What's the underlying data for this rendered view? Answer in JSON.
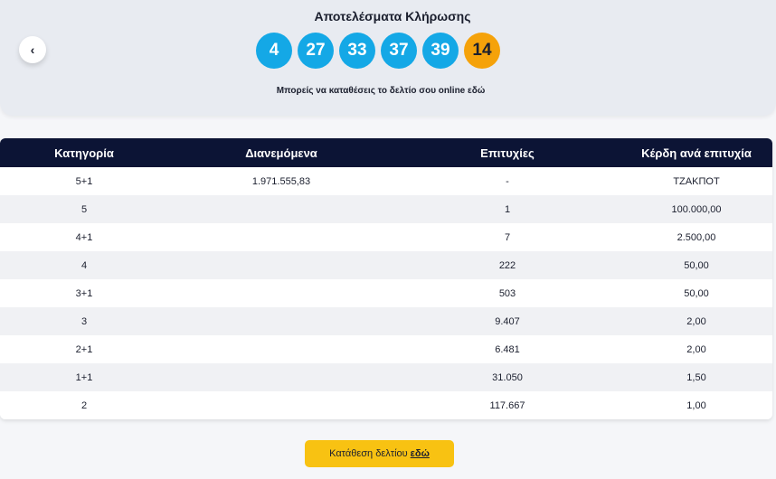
{
  "header": {
    "title": "Αποτελέσματα Κλήρωσης",
    "back_icon": "chevron-left-icon",
    "balls": [
      {
        "value": "4",
        "color": "#14a8e6",
        "kind": "main"
      },
      {
        "value": "27",
        "color": "#14a8e6",
        "kind": "main"
      },
      {
        "value": "33",
        "color": "#14a8e6",
        "kind": "main"
      },
      {
        "value": "37",
        "color": "#14a8e6",
        "kind": "main"
      },
      {
        "value": "39",
        "color": "#14a8e6",
        "kind": "main"
      },
      {
        "value": "14",
        "color": "#f5a20a",
        "kind": "joker"
      }
    ],
    "online_text": "Μπορείς να καταθέσεις το δελτίο σου online",
    "online_link": "εδώ"
  },
  "table": {
    "headers": [
      "Κατηγορία",
      "Διανεμόμενα",
      "Επιτυχίες",
      "Κέρδη ανά επιτυχία"
    ],
    "rows": [
      [
        "5+1",
        "1.971.555,83",
        "-",
        "ΤΖΑΚΠΟΤ"
      ],
      [
        "5",
        "",
        "1",
        "100.000,00"
      ],
      [
        "4+1",
        "",
        "7",
        "2.500,00"
      ],
      [
        "4",
        "",
        "222",
        "50,00"
      ],
      [
        "3+1",
        "",
        "503",
        "50,00"
      ],
      [
        "3",
        "",
        "9.407",
        "2,00"
      ],
      [
        "2+1",
        "",
        "6.481",
        "2,00"
      ],
      [
        "1+1",
        "",
        "31.050",
        "1,50"
      ],
      [
        "2",
        "",
        "117.667",
        "1,00"
      ]
    ]
  },
  "cta": {
    "text": "Κατάθεση δελτίου",
    "link": "εδώ",
    "color": "#f8c212"
  },
  "colors": {
    "header_bg": "#0c1435",
    "panel_bg": "#e8ebf1"
  }
}
